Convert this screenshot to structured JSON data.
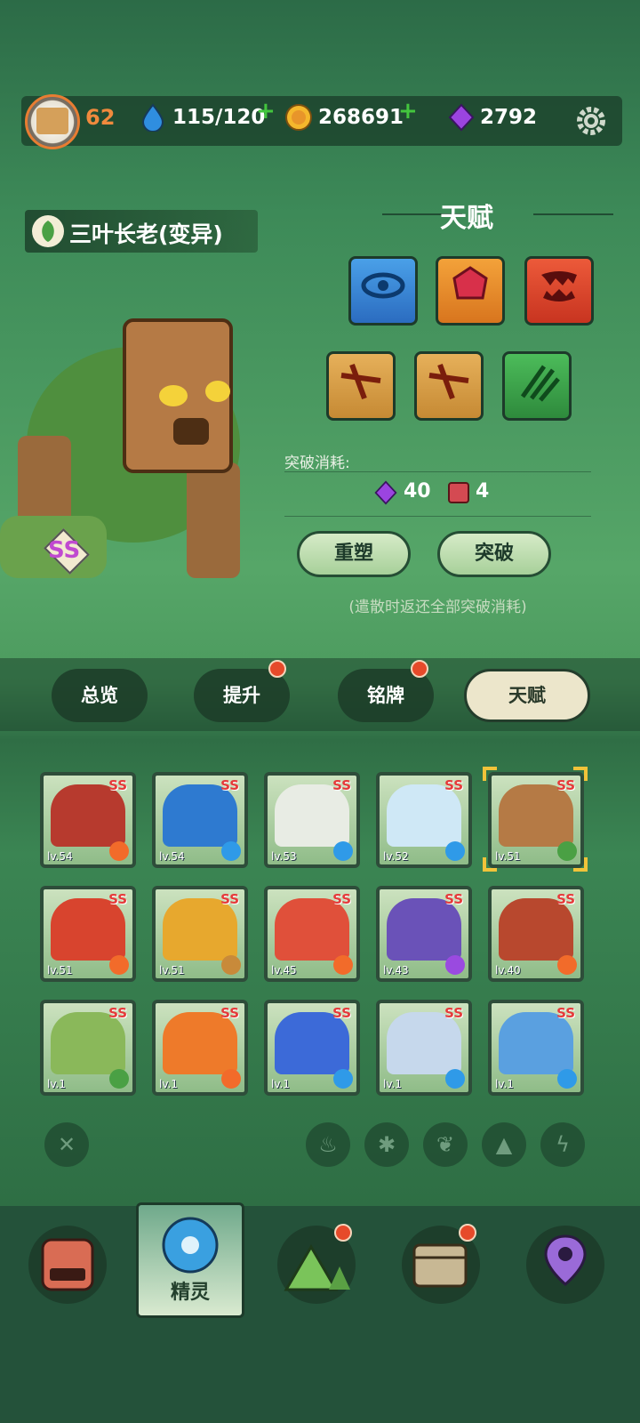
{
  "header": {
    "player_level": "62",
    "stamina": "115/120",
    "coins": "268691",
    "gems": "2792"
  },
  "pet": {
    "name": "三叶长老(变异)",
    "rarity": "SS"
  },
  "talent": {
    "title": "天赋",
    "break_label": "突破消耗:",
    "cost_gem": "40",
    "cost_item": "4",
    "reshape_label": "重塑",
    "break_button": "突破",
    "hint": "(遣散时返还全部突破消耗)"
  },
  "tabs": [
    {
      "label": "总览",
      "badge": false
    },
    {
      "label": "提升",
      "badge": true
    },
    {
      "label": "铭牌",
      "badge": true
    },
    {
      "label": "天赋",
      "badge": false,
      "active": true
    }
  ],
  "pets": [
    {
      "rarity": "SS",
      "level": "lv.54",
      "element": "fire"
    },
    {
      "rarity": "SS",
      "level": "lv.54",
      "element": "ice"
    },
    {
      "rarity": "SS",
      "level": "lv.53",
      "element": "ice"
    },
    {
      "rarity": "SS",
      "level": "lv.52",
      "element": "ice"
    },
    {
      "rarity": "SS",
      "level": "lv.51",
      "element": "grass",
      "selected": true
    },
    {
      "rarity": "SS",
      "level": "lv.51",
      "element": "fire"
    },
    {
      "rarity": "SS",
      "level": "lv.51",
      "element": "rock"
    },
    {
      "rarity": "SS",
      "level": "lv.45",
      "element": "fire"
    },
    {
      "rarity": "SS",
      "level": "lv.43",
      "element": "electric"
    },
    {
      "rarity": "SS",
      "level": "lv.40",
      "element": "fire"
    },
    {
      "rarity": "SS",
      "level": "lv.1",
      "element": "grass"
    },
    {
      "rarity": "SS",
      "level": "lv.1",
      "element": "fire"
    },
    {
      "rarity": "SS",
      "level": "lv.1",
      "element": "ice"
    },
    {
      "rarity": "SS",
      "level": "lv.1",
      "element": "ice"
    },
    {
      "rarity": "SS",
      "level": "lv.1",
      "element": "ice"
    }
  ],
  "nav": {
    "active_label": "精灵"
  },
  "colors": {
    "accent_orange": "#f08a3d",
    "badge_red": "#e64a2a",
    "plus_green": "#43c63e",
    "selection_gold": "#f1c33a"
  }
}
